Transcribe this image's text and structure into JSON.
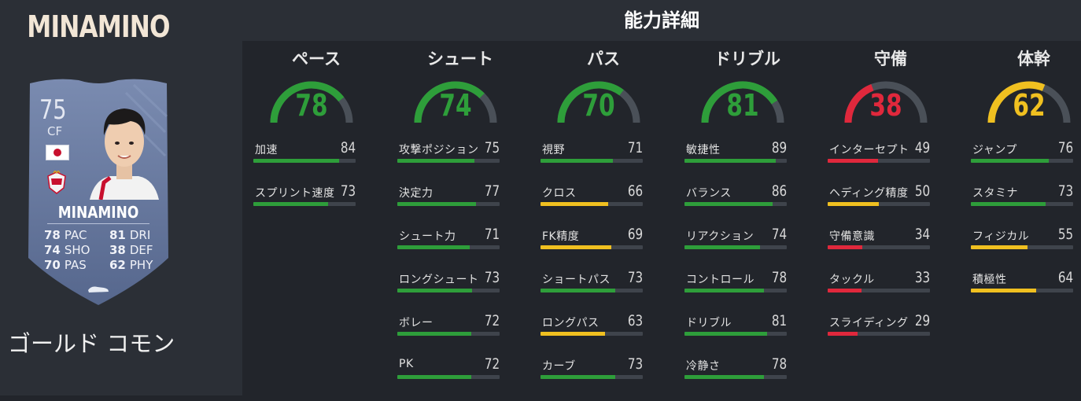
{
  "player": {
    "name": "MINAMINO",
    "card_name": "MINAMINO",
    "rating": "75",
    "position": "CF",
    "card_type": "ゴールド コモン",
    "card_stats": [
      {
        "value": "78",
        "label": "PAC"
      },
      {
        "value": "81",
        "label": "DRI"
      },
      {
        "value": "74",
        "label": "SHO"
      },
      {
        "value": "38",
        "label": "DEF"
      },
      {
        "value": "70",
        "label": "PAS"
      },
      {
        "value": "62",
        "label": "PHY"
      }
    ]
  },
  "details": {
    "title": "能力詳細",
    "categories": [
      {
        "name": "ペース",
        "value": "78",
        "attributes": [
          {
            "label": "加速",
            "value": "84"
          },
          {
            "label": "スプリント速度",
            "value": "73"
          }
        ]
      },
      {
        "name": "シュート",
        "value": "74",
        "attributes": [
          {
            "label": "攻撃ポジション",
            "value": "75"
          },
          {
            "label": "決定力",
            "value": "77"
          },
          {
            "label": "シュート力",
            "value": "71"
          },
          {
            "label": "ロングシュート",
            "value": "73"
          },
          {
            "label": "ボレー",
            "value": "72"
          },
          {
            "label": "PK",
            "value": "72"
          }
        ]
      },
      {
        "name": "パス",
        "value": "70",
        "attributes": [
          {
            "label": "視野",
            "value": "71"
          },
          {
            "label": "クロス",
            "value": "66"
          },
          {
            "label": "FK精度",
            "value": "69"
          },
          {
            "label": "ショートパス",
            "value": "73"
          },
          {
            "label": "ロングパス",
            "value": "63"
          },
          {
            "label": "カーブ",
            "value": "73"
          }
        ]
      },
      {
        "name": "ドリブル",
        "value": "81",
        "attributes": [
          {
            "label": "敏捷性",
            "value": "89"
          },
          {
            "label": "バランス",
            "value": "86"
          },
          {
            "label": "リアクション",
            "value": "74"
          },
          {
            "label": "コントロール",
            "value": "78"
          },
          {
            "label": "ドリブル",
            "value": "81"
          },
          {
            "label": "冷静さ",
            "value": "78"
          }
        ]
      },
      {
        "name": "守備",
        "value": "38",
        "attributes": [
          {
            "label": "インターセプト",
            "value": "49"
          },
          {
            "label": "ヘディング精度",
            "value": "50"
          },
          {
            "label": "守備意識",
            "value": "34"
          },
          {
            "label": "タックル",
            "value": "33"
          },
          {
            "label": "スライディング",
            "value": "29"
          }
        ]
      },
      {
        "name": "体幹",
        "value": "62",
        "attributes": [
          {
            "label": "ジャンプ",
            "value": "76"
          },
          {
            "label": "スタミナ",
            "value": "73"
          },
          {
            "label": "フィジカル",
            "value": "55"
          },
          {
            "label": "積極性",
            "value": "64"
          }
        ]
      }
    ]
  },
  "colors": {
    "high": "#2e9e3a",
    "mid": "#f0c020",
    "low": "#e0283c",
    "track": "#4a5058"
  }
}
